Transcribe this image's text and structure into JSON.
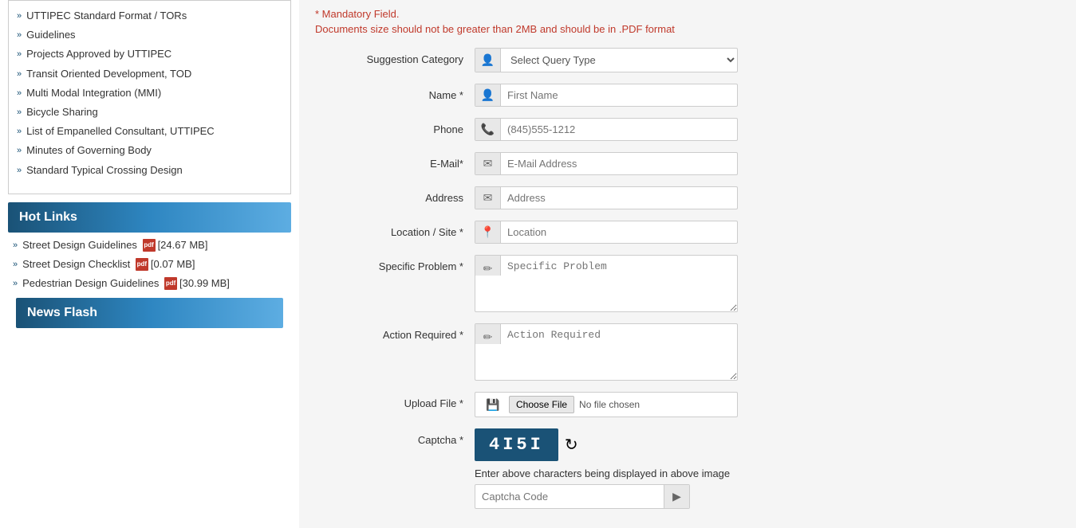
{
  "sidebar": {
    "items": [
      {
        "label": "UTTIPEC Standard Format / TORs"
      },
      {
        "label": "Guidelines"
      },
      {
        "label": "Projects Approved by UTTIPEC"
      },
      {
        "label": "Transit Oriented Development, TOD"
      },
      {
        "label": "Multi Modal Integration (MMI)"
      },
      {
        "label": "Bicycle Sharing"
      },
      {
        "label": "List of Empanelled Consultant, UTTIPEC"
      },
      {
        "label": "Minutes of Governing Body"
      },
      {
        "label": "Standard Typical Crossing Design"
      }
    ]
  },
  "hot_links": {
    "header": "Hot Links",
    "items": [
      {
        "label": "Street Design Guidelines",
        "size": "[24.67 MB]"
      },
      {
        "label": "Street Design Checklist",
        "size": "[0.07 MB]"
      },
      {
        "label": "Pedestrian Design Guidelines",
        "size": "[30.99 MB]"
      }
    ]
  },
  "news_flash": {
    "header": "News Flash"
  },
  "form": {
    "mandatory_notice": "* Mandatory Field.",
    "mandatory_notice_sub": "Documents size should not be greater than 2MB and should be in .PDF format",
    "suggestion_category_label": "Suggestion Category",
    "suggestion_category_placeholder": "Select Query Type",
    "name_label": "Name *",
    "name_placeholder": "First Name",
    "phone_label": "Phone",
    "phone_placeholder": "(845)555-1212",
    "email_label": "E-Mail*",
    "email_placeholder": "E-Mail Address",
    "address_label": "Address",
    "address_placeholder": "Address",
    "location_label": "Location / Site *",
    "location_placeholder": "Location",
    "specific_problem_label": "Specific Problem *",
    "specific_problem_placeholder": "Specific Problem",
    "action_required_label": "Action Required *",
    "action_required_placeholder": "Action Required",
    "upload_file_label": "Upload File *",
    "choose_file_label": "Choose File",
    "no_file_chosen": "No file chosen",
    "captcha_label": "Captcha *",
    "captcha_text": "4I5I",
    "captcha_instruction": "Enter above characters being displayed in above image",
    "captcha_code_placeholder": "Captcha Code"
  }
}
